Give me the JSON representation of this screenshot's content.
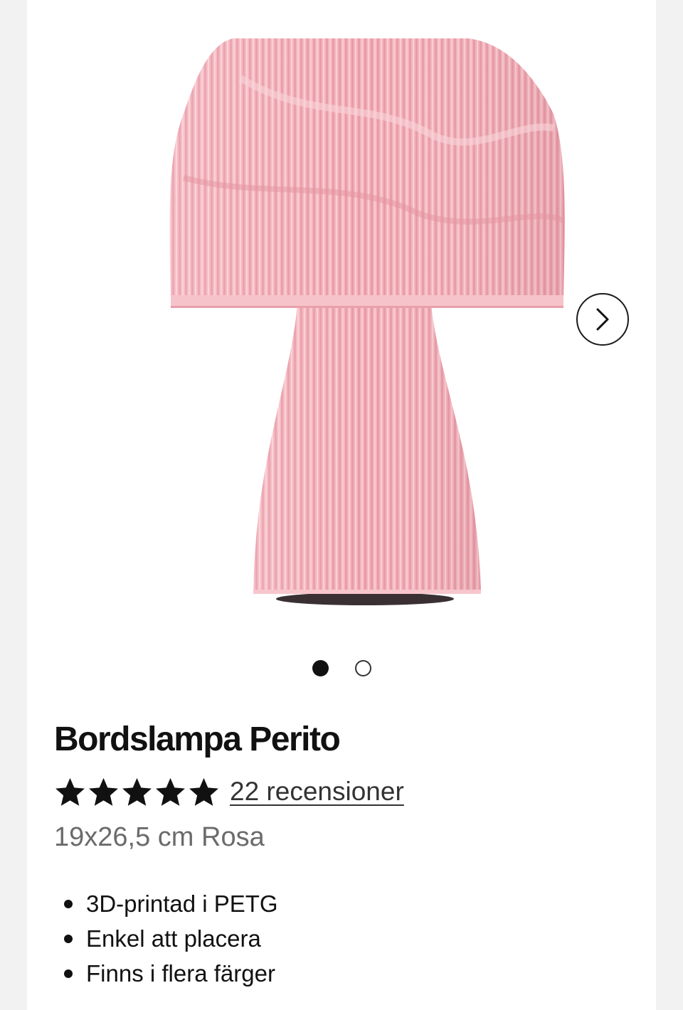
{
  "product": {
    "image_alt": "Bordslampa Perito rosa",
    "title": "Bordslampa Perito",
    "rating_stars": 5,
    "reviews_label": "22 recensioner",
    "variant": "19x26,5 cm Rosa",
    "features": [
      "3D-printad i PETG",
      "Enkel att placera",
      "Finns i flera färger"
    ]
  },
  "carousel": {
    "total_slides": 2,
    "active_slide": 1,
    "next_icon": "chevron-right-icon"
  },
  "colors": {
    "lamp_pink": "#f4b3bc",
    "text_primary": "#111111",
    "text_secondary": "#6b6b6b"
  }
}
